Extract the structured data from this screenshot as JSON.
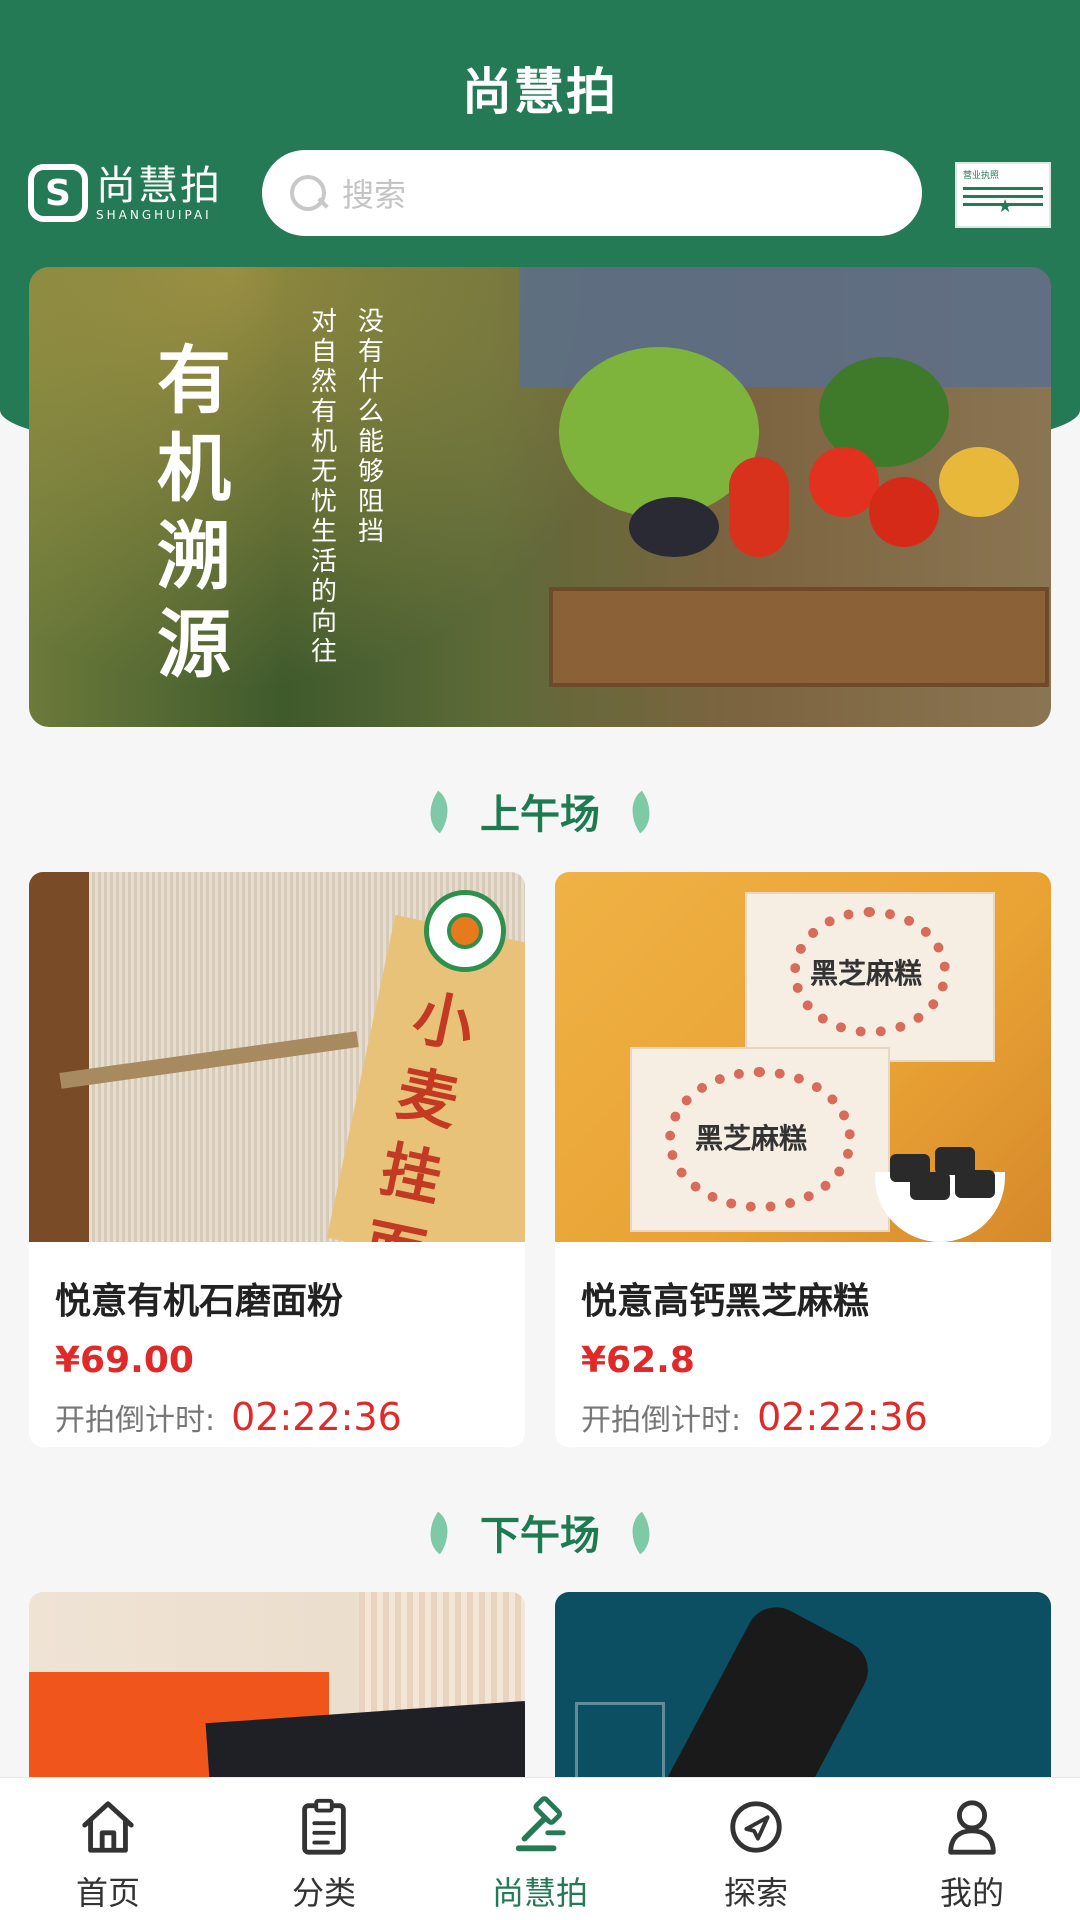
{
  "header": {
    "title": "尚慧拍",
    "logo_cn": "尚慧拍",
    "logo_en": "SHANGHUIPAI",
    "search_placeholder": "搜索",
    "license_label": "营业执照"
  },
  "banner": {
    "title_chars": [
      "有",
      "机",
      "溯",
      "源"
    ],
    "poem_line1": "没有什么能够阻挡",
    "poem_line2": "对自然有机无忧生活的向往"
  },
  "sections": {
    "morning": "上午场",
    "afternoon": "下午场"
  },
  "morning_products": [
    {
      "name": "悦意有机石磨面粉",
      "price": "¥69.00",
      "countdown_label": "开拍倒计时:",
      "countdown": "02:22:36",
      "image_text": "小麦挂面"
    },
    {
      "name": "悦意高钙黑芝麻糕",
      "price": "¥62.8",
      "countdown_label": "开拍倒计时:",
      "countdown": "02:22:36",
      "image_text": "黑芝麻糕"
    }
  ],
  "tabs": [
    {
      "label": "首页",
      "icon": "home-icon",
      "active": false
    },
    {
      "label": "分类",
      "icon": "clipboard-icon",
      "active": false
    },
    {
      "label": "尚慧拍",
      "icon": "gavel-icon",
      "active": true
    },
    {
      "label": "探索",
      "icon": "compass-icon",
      "active": false
    },
    {
      "label": "我的",
      "icon": "user-icon",
      "active": false
    }
  ],
  "colors": {
    "brand_green": "#237a55",
    "price_red": "#e02a2a",
    "background": "#f6f6f6"
  }
}
